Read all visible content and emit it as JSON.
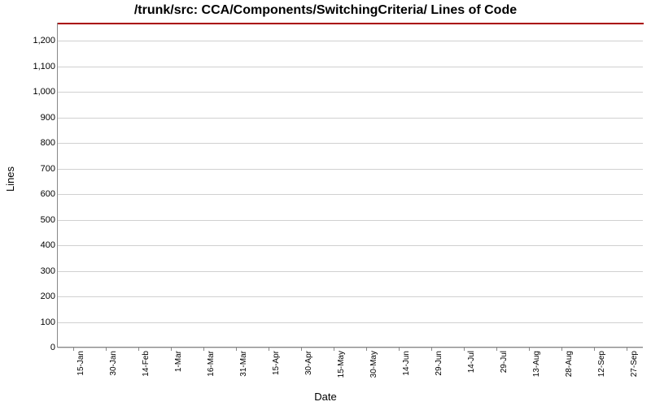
{
  "chart_data": {
    "type": "line",
    "title": "/trunk/src: CCA/Components/SwitchingCriteria/ Lines of Code",
    "xlabel": "Date",
    "ylabel": "Lines",
    "ylim": [
      0,
      1270
    ],
    "y_ticks": [
      0,
      100,
      200,
      300,
      400,
      500,
      600,
      700,
      800,
      900,
      1000,
      1100,
      1200
    ],
    "categories": [
      "15-Jan",
      "30-Jan",
      "14-Feb",
      "1-Mar",
      "16-Mar",
      "31-Mar",
      "15-Apr",
      "30-Apr",
      "15-May",
      "30-May",
      "14-Jun",
      "29-Jun",
      "14-Jul",
      "29-Jul",
      "13-Aug",
      "28-Aug",
      "12-Sep",
      "27-Sep"
    ],
    "series": [
      {
        "name": "Lines of Code",
        "color": "#aa0000",
        "values": [
          1270,
          1270,
          1270,
          1270,
          1270,
          1270,
          1270,
          1270,
          1270,
          1270,
          1270,
          1270,
          1270,
          1270,
          1270,
          1270,
          1270,
          1270
        ]
      }
    ]
  }
}
